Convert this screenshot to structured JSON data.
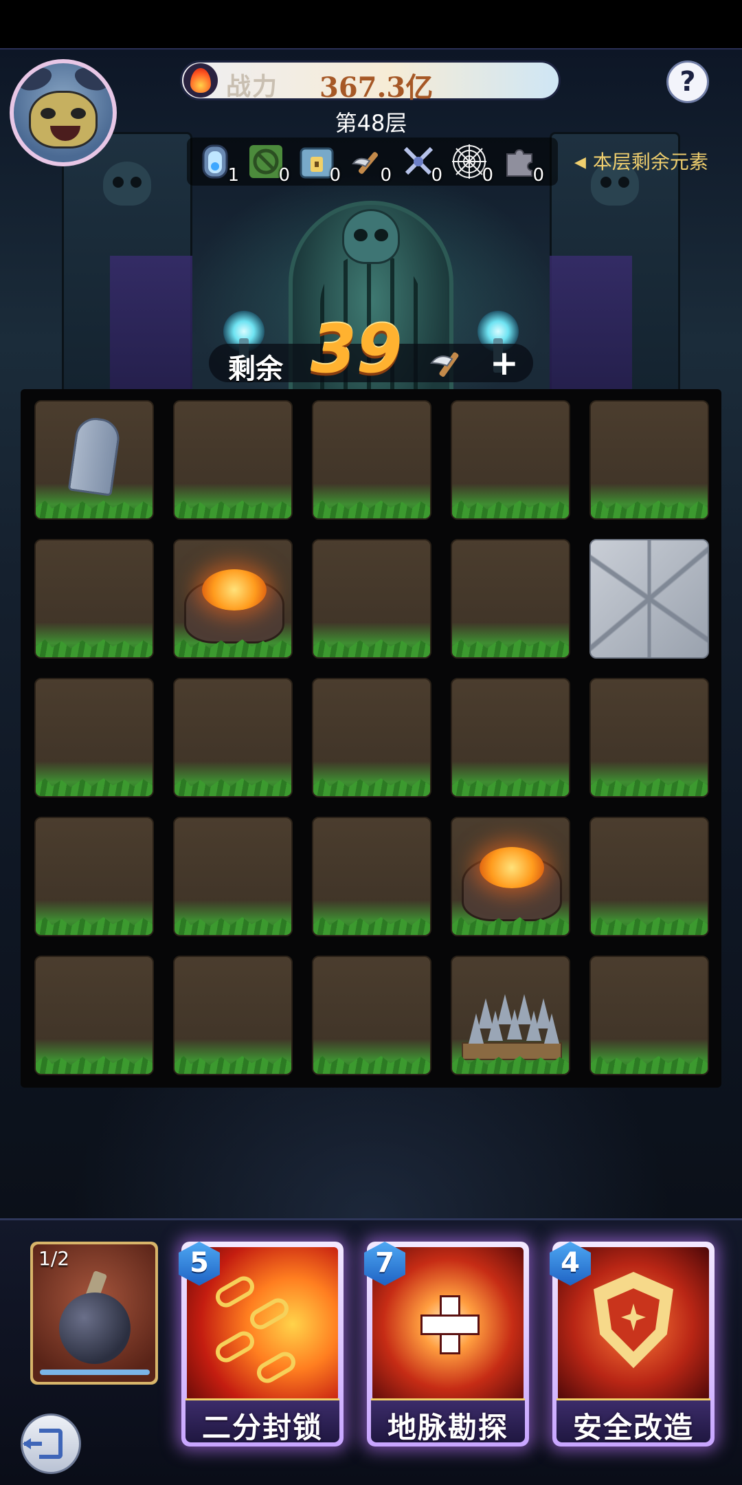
{
  "header": {
    "power_label": "战力",
    "power_value": "367.3亿",
    "floor": "第48层",
    "help_icon": "question-mark-icon"
  },
  "elements_bar": {
    "items": [
      {
        "name": "portal-icon",
        "count": "1"
      },
      {
        "name": "forbidden-icon",
        "count": "0"
      },
      {
        "name": "treasure-chest-icon",
        "count": "0"
      },
      {
        "name": "pickaxe-icon",
        "count": "0"
      },
      {
        "name": "crossed-swords-icon",
        "count": "0"
      },
      {
        "name": "spider-web-icon",
        "count": "0"
      },
      {
        "name": "puzzle-piece-icon",
        "count": "0"
      }
    ],
    "remaining_label": "本层剩余元素"
  },
  "remaining": {
    "label": "剩余",
    "count": "39",
    "add": "+"
  },
  "board": {
    "rows": 5,
    "cols": 5,
    "tiles": [
      [
        "tombstone",
        "dirt",
        "dirt",
        "dirt",
        "dirt"
      ],
      [
        "dirt",
        "lava",
        "dirt",
        "dirt",
        "stone"
      ],
      [
        "dirt",
        "dirt",
        "dirt",
        "dirt",
        "dirt"
      ],
      [
        "dirt",
        "dirt",
        "dirt",
        "lava",
        "dirt"
      ],
      [
        "dirt",
        "dirt",
        "dirt",
        "spikes",
        "dirt"
      ]
    ]
  },
  "inventory": {
    "bomb": {
      "count": "1/2",
      "progress": 1.0
    }
  },
  "skills": [
    {
      "cost": "5",
      "name": "二分封锁",
      "art": "chain"
    },
    {
      "cost": "7",
      "name": "地脉勘探",
      "art": "dig"
    },
    {
      "cost": "4",
      "name": "安全改造",
      "art": "safe"
    }
  ],
  "colors": {
    "accent_gold": "#f0cf6e",
    "remaining_orange": "#ffb230",
    "power_text": "#a65826",
    "skill_glow": "#be78ff"
  }
}
